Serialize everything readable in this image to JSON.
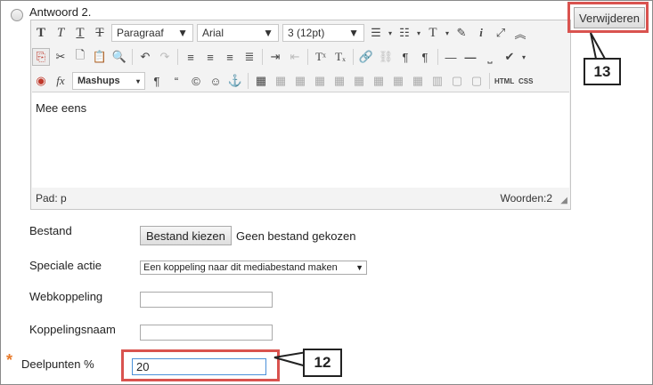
{
  "question": {
    "label": "Antwoord 2."
  },
  "editor": {
    "row1": {
      "format": "Paragraaf",
      "font": "Arial",
      "size": "3 (12pt)"
    },
    "row3": {
      "mashups": "Mashups",
      "html": "HTML",
      "css": "CSS"
    },
    "content": "Mee eens",
    "status_path": "Pad: p",
    "status_words": "Woorden:2"
  },
  "delete_button": "Verwijderen",
  "callouts": {
    "c13": "13",
    "c12": "12"
  },
  "fields": {
    "bestand": {
      "label": "Bestand",
      "button": "Bestand kiezen",
      "status": "Geen bestand gekozen"
    },
    "speciale_actie": {
      "label": "Speciale actie",
      "value": "Een koppeling naar dit mediabestand maken"
    },
    "webkoppeling": {
      "label": "Webkoppeling",
      "value": ""
    },
    "koppelingsnaam": {
      "label": "Koppelingsnaam",
      "value": ""
    },
    "deelpunten": {
      "label": "Deelpunten %",
      "value": "20",
      "required_mark": "*"
    }
  },
  "colors": {
    "highlight": "#d9534f",
    "required": "#e87a2a"
  }
}
